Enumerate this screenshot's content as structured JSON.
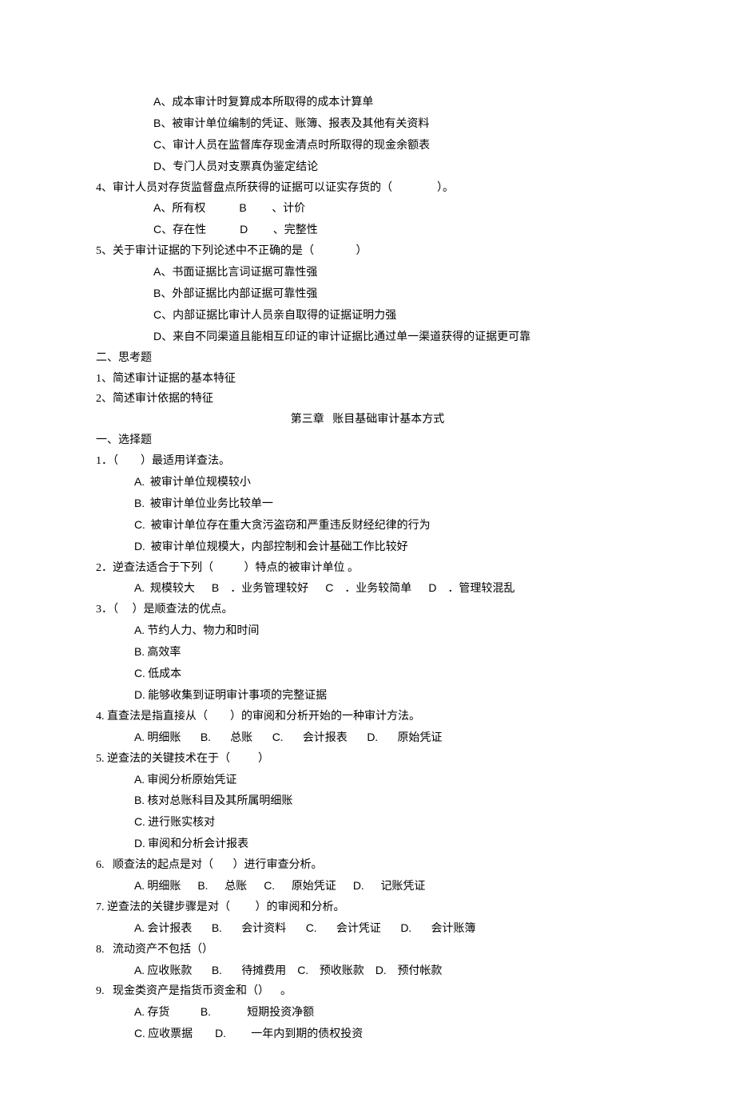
{
  "lines": [
    {
      "cls": "indent-2",
      "text": "A、成本审计时复算成本所取得的成本计算单"
    },
    {
      "cls": "indent-2",
      "text": "B、被审计单位编制的凭证、账簿、报表及其他有关资料"
    },
    {
      "cls": "indent-2",
      "text": "C、审计人员在监督库存现金清点时所取得的现金余额表"
    },
    {
      "cls": "indent-2",
      "text": "D、专门人员对支票真伪鉴定结论"
    },
    {
      "cls": "",
      "text": "4、审计人员对存货监督盘点所获得的证据可以证实存货的（                ）。"
    },
    {
      "cls": "indent-2",
      "text": "A、所有权            B         、计价"
    },
    {
      "cls": "indent-2",
      "text": "C、存在性            D         、完整性"
    },
    {
      "cls": "",
      "text": "5、关于审计证据的下列论述中不正确的是（               ）"
    },
    {
      "cls": "indent-2",
      "text": "A、书面证据比言词证据可靠性强"
    },
    {
      "cls": "indent-2",
      "text": "B、外部证据比内部证据可靠性强"
    },
    {
      "cls": "indent-2",
      "text": "C、内部证据比审计人员亲自取得的证据证明力强"
    },
    {
      "cls": "indent-2",
      "text": "D、来自不同渠道且能相互印证的审计证据比通过单一渠道获得的证据更可靠"
    },
    {
      "cls": "",
      "text": "二、思考题"
    },
    {
      "cls": "",
      "text": "1、简述审计证据的基本特征"
    },
    {
      "cls": "",
      "text": "2、简述审计依据的特征"
    },
    {
      "cls": "chapter-title",
      "text": "第三章   账目基础审计基本方式"
    },
    {
      "cls": "",
      "text": "一、选择题"
    },
    {
      "cls": "",
      "text": "1．（        ）最适用详查法。"
    },
    {
      "cls": "indent-1",
      "text": "A.  被审计单位规模较小"
    },
    {
      "cls": "indent-1",
      "text": "B.  被审计单位业务比较单一"
    },
    {
      "cls": "indent-1",
      "text": "C.  被审计单位存在重大贪污盗窃和严重违反财经纪律的行为"
    },
    {
      "cls": "indent-1",
      "text": "D.  被审计单位规模大，内部控制和会计基础工作比较好"
    },
    {
      "cls": "",
      "text": "2．逆查法适合于下列（           ）特点的被审计单位 。"
    },
    {
      "cls": "indent-1",
      "text": "A.  规模较大      B    ．业务管理较好      C    ．业务较简单      D    ．管理较混乱"
    },
    {
      "cls": "",
      "text": "3．（     ）是顺查法的优点。"
    },
    {
      "cls": "indent-1",
      "text": "A. 节约人力、物力和时间"
    },
    {
      "cls": "indent-1",
      "text": "B. 高效率"
    },
    {
      "cls": "indent-1",
      "text": "C. 低成本"
    },
    {
      "cls": "indent-1",
      "text": "D. 能够收集到证明审计事项的完整证据"
    },
    {
      "cls": "",
      "text": "4. 直查法是指直接从（        ）的审阅和分析开始的一种审计方法。"
    },
    {
      "cls": "indent-1",
      "text": "A. 明细账       B.       总账       C.       会计报表       D.       原始凭证"
    },
    {
      "cls": "",
      "text": "5. 逆查法的关键技术在于（          ）"
    },
    {
      "cls": "indent-1",
      "text": "A. 审阅分析原始凭证"
    },
    {
      "cls": "indent-1",
      "text": "B. 核对总账科目及其所属明细账"
    },
    {
      "cls": "indent-1",
      "text": "C. 进行账实核对"
    },
    {
      "cls": "indent-1",
      "text": "D. 审阅和分析会计报表"
    },
    {
      "cls": "",
      "text": "6.   顺查法的起点是对（       ）进行审查分析。"
    },
    {
      "cls": "indent-1",
      "text": "A. 明细账      B.      总账      C.      原始凭证      D.      记账凭证"
    },
    {
      "cls": "",
      "text": "7. 逆查法的关键步骤是对（         ）的审阅和分析。"
    },
    {
      "cls": "indent-1",
      "text": "A. 会计报表       B.       会计资料       C.       会计凭证       D.       会计账簿"
    },
    {
      "cls": "",
      "text": "8.   流动资产不包括（）"
    },
    {
      "cls": "indent-1",
      "text": "A. 应收账款       B.       待摊费用    C.    预收账款    D.    预付帐款"
    },
    {
      "cls": "",
      "text": "9.   现金类资产是指货币资金和（）    。"
    },
    {
      "cls": "indent-1",
      "text": "A. 存货           B.             短期投资净额"
    },
    {
      "cls": "indent-1",
      "text": "C. 应收票据        D.         一年内到期的债权投资"
    }
  ]
}
